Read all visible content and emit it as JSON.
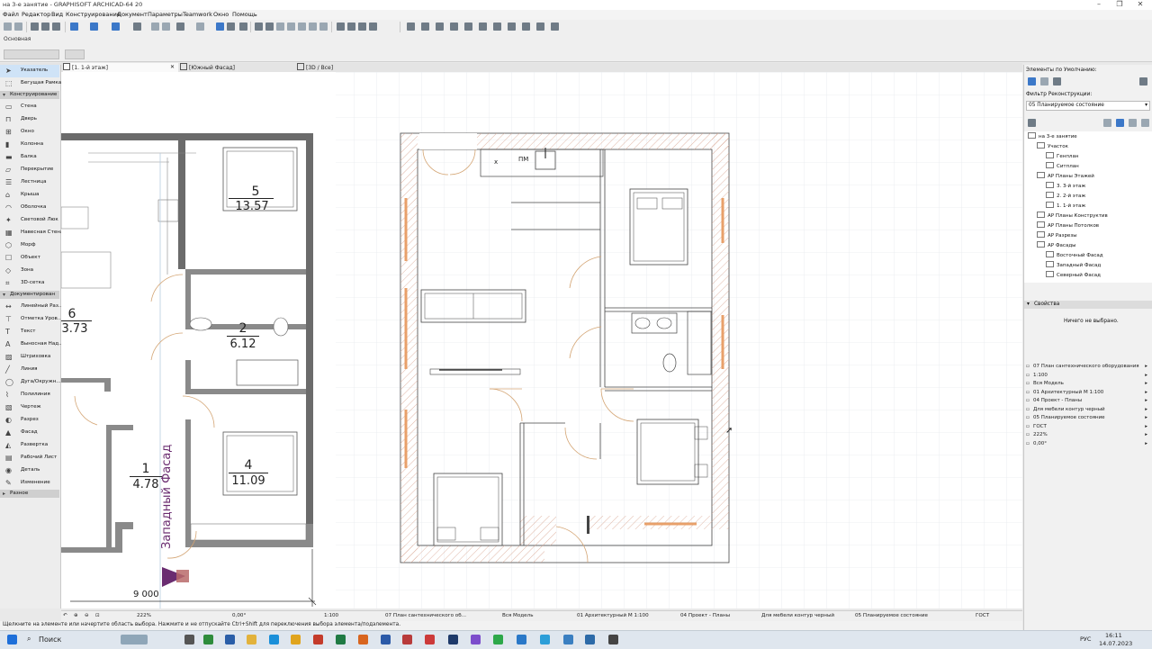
{
  "window": {
    "title": "на 3-е занятие - GRAPHISOFT ARCHICAD-64 20"
  },
  "menu": [
    "Файл",
    "Редактор",
    "Вид",
    "Конструирование",
    "Документ",
    "Параметры",
    "Teamwork",
    "Окно",
    "Помощь"
  ],
  "infobox": {
    "label": "Основная"
  },
  "tabs": [
    {
      "label": "[1. 1-й этаж]"
    },
    {
      "label": "[Южный Фасад]"
    },
    {
      "label": "[3D / Все]"
    }
  ],
  "toolbox": {
    "pointer": "Указатель",
    "marquee": "Бегущая Рамка",
    "section_design": "Конструирование",
    "design_tools": [
      "Стена",
      "Дверь",
      "Окно",
      "Колонна",
      "Балка",
      "Перекрытие",
      "Лестница",
      "Крыша",
      "Оболочка",
      "Световой Люк",
      "Навесная Стена",
      "Морф",
      "Объект",
      "Зона",
      "3D-сетка"
    ],
    "section_doc": "Документирован",
    "doc_tools": [
      "Линейный Раз...",
      "Отметка Уров...",
      "Текст",
      "Выносная Над...",
      "Штриховка",
      "Линия",
      "Дуга/Окружн...",
      "Полилиния",
      "Чертеж",
      "Разрез",
      "Фасад",
      "Развертка",
      "Рабочий Лист",
      "Деталь",
      "Изменение"
    ],
    "section_more": "Разное"
  },
  "drawing": {
    "rooms": [
      {
        "number": "5",
        "area": "13.57"
      },
      {
        "number": "6",
        "area": "3.73"
      },
      {
        "number": "2",
        "area": "6.12"
      },
      {
        "number": "1",
        "area": "4.78"
      },
      {
        "number": "4",
        "area": "11.09"
      }
    ],
    "elevation_marker": "Западный Фасад",
    "dimension": "9 000",
    "labels": {
      "x": "x",
      "pm": "ПМ"
    }
  },
  "statusbar": {
    "zoom": "222%",
    "angle": "0,00°",
    "scale": "1:100",
    "layer_combo": "07 План сантехнического об...",
    "model_view": "Вся Модель",
    "pen_set": "01 Архитектурный М 1:100",
    "view_map": "04 Проект - Планы",
    "graphic_override": "Для мебели контур черный",
    "renovation": "05 Планируемое состояние",
    "dim_standard": "ГОСТ"
  },
  "hint": "Щелкните на элементе или начертите область выбора. Нажмите и не отпускайте Ctrl+Shift для переключения выбора элемента/подэлемента.",
  "right_panel": {
    "defaults_title": "Элементы по Умолчанию:",
    "renovation_label": "Фильтр Реконструкции:",
    "renovation_value": "05 Планируемое состояние",
    "tree": [
      {
        "label": "на 3-е занятие",
        "indent": 0
      },
      {
        "label": "Участок",
        "indent": 1
      },
      {
        "label": "Генплан",
        "indent": 2
      },
      {
        "label": "Ситплан",
        "indent": 2
      },
      {
        "label": "АР Планы Этажей",
        "indent": 1
      },
      {
        "label": "3. 3-й этаж",
        "indent": 2
      },
      {
        "label": "2. 2-й этаж",
        "indent": 2
      },
      {
        "label": "1. 1-й этаж",
        "indent": 2
      },
      {
        "label": "АР Планы Конструктив",
        "indent": 1
      },
      {
        "label": "АР Планы Потолков",
        "indent": 1
      },
      {
        "label": "АР Разрезы",
        "indent": 1
      },
      {
        "label": "АР Фасады",
        "indent": 1
      },
      {
        "label": "Восточный Фасад",
        "indent": 2
      },
      {
        "label": "Западный Фасад",
        "indent": 2
      },
      {
        "label": "Северный Фасад",
        "indent": 2
      }
    ],
    "properties_title": "Свойства",
    "nothing_selected": "Ничего не выбрано.",
    "view_settings": [
      "07 План сантехнического оборудования",
      "1:100",
      "Вся Модель",
      "01 Архитектурный М 1:100",
      "04 Проект - Планы",
      "Для мебели контур черный",
      "05 Планируемое состояние",
      "ГОСТ",
      "222%",
      "0,00°"
    ]
  },
  "taskbar": {
    "search": "Поиск",
    "lang": "РУС",
    "time": "16:11",
    "date": "14.07.2023"
  }
}
